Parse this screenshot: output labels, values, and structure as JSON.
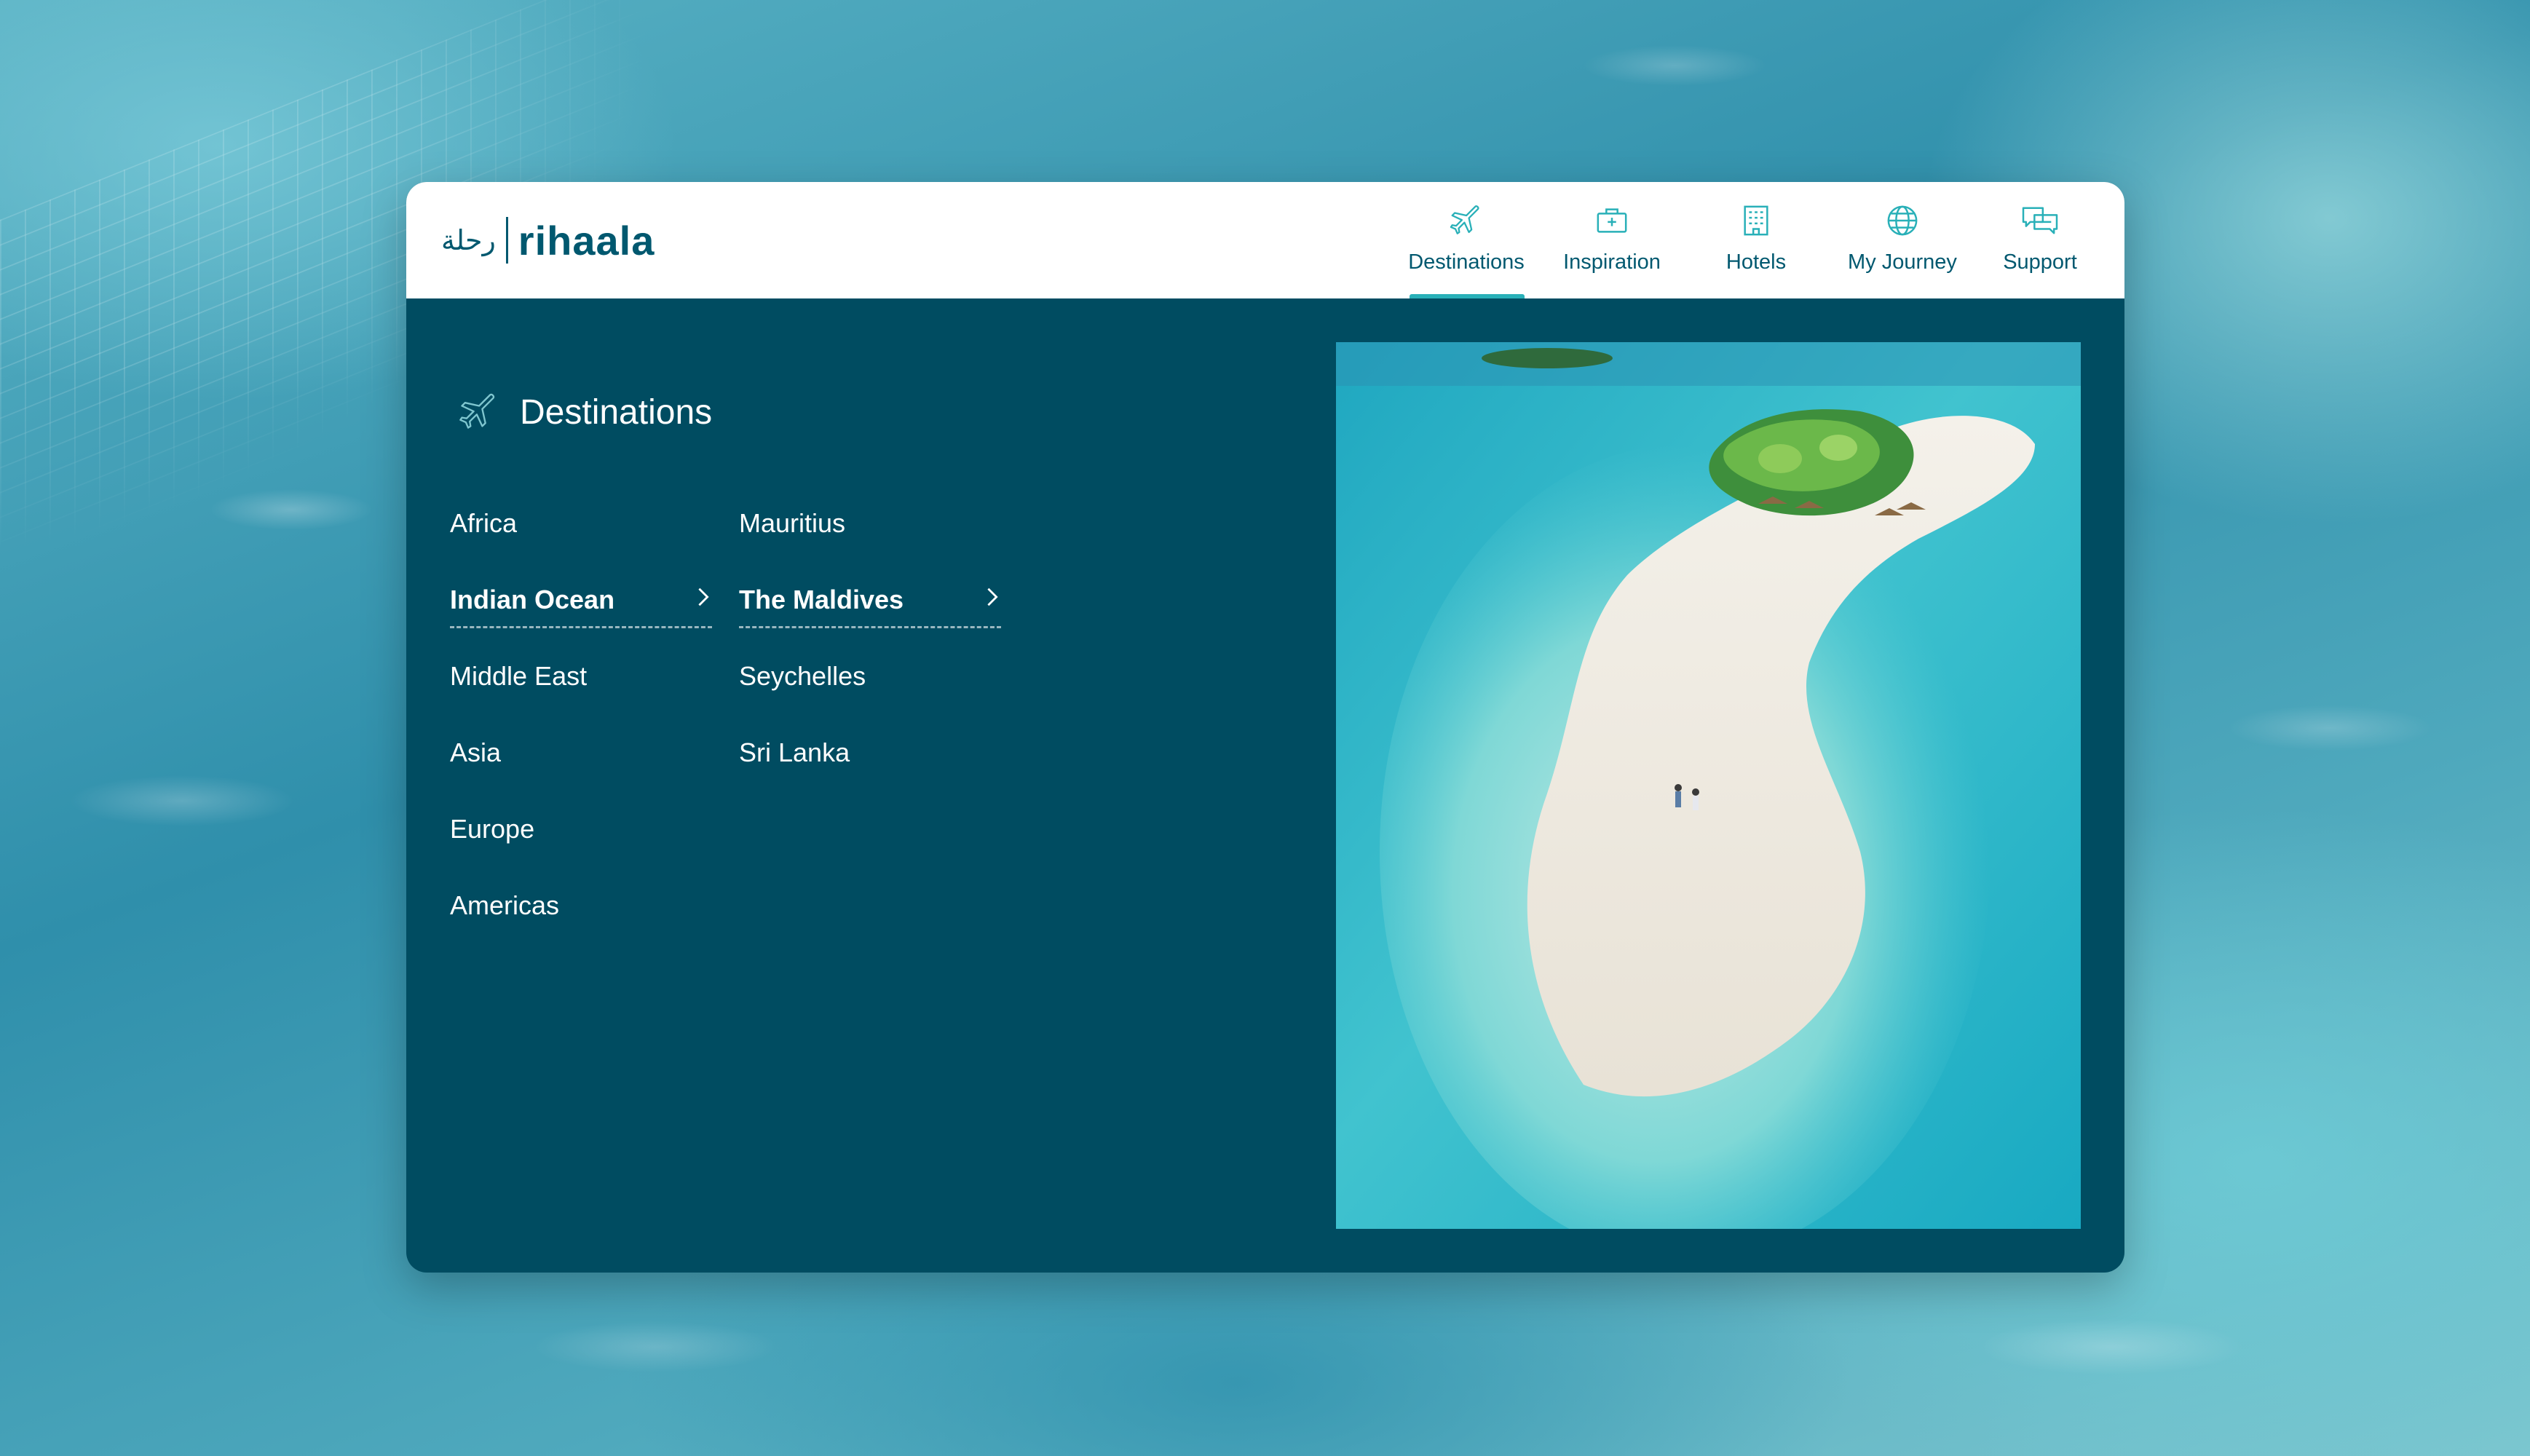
{
  "app": {
    "logo_arabic": "رحلة",
    "logo_text": "rihaala"
  },
  "nav": [
    {
      "label": "Destinations",
      "icon": "airplane-icon",
      "active": true
    },
    {
      "label": "Inspiration",
      "icon": "briefcase-icon",
      "active": false
    },
    {
      "label": "Hotels",
      "icon": "hotel-building-icon",
      "active": false
    },
    {
      "label": "My Journey",
      "icon": "globe-icon",
      "active": false
    },
    {
      "label": "Support",
      "icon": "chat-bubbles-icon",
      "active": false
    }
  ],
  "panel": {
    "title": "Destinations",
    "title_icon": "airplane-icon",
    "regions": [
      {
        "label": "Africa",
        "active": false
      },
      {
        "label": "Indian Ocean",
        "active": true
      },
      {
        "label": "Middle East",
        "active": false
      },
      {
        "label": "Asia",
        "active": false
      },
      {
        "label": "Europe",
        "active": false
      },
      {
        "label": "Americas",
        "active": false
      }
    ],
    "countries": [
      {
        "label": "Mauritius",
        "active": false
      },
      {
        "label": "The Maldives",
        "active": true
      },
      {
        "label": "Seychelles",
        "active": false
      },
      {
        "label": "Sri Lanka",
        "active": false
      }
    ]
  },
  "colors": {
    "brand": "#00586f",
    "panel_bg": "#004c61",
    "accent": "#29b0b8"
  }
}
